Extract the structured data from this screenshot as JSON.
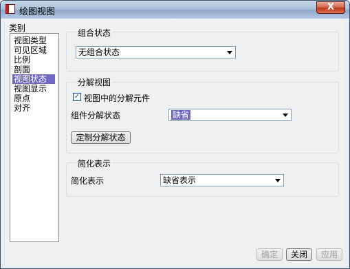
{
  "window": {
    "title": "绘图视图",
    "close_glyph": "X"
  },
  "category": {
    "label": "类别",
    "items": [
      "视图类型",
      "可见区域",
      "比例",
      "剖面",
      "视图状态",
      "视图显示",
      "原点",
      "对齐"
    ],
    "selected_index": 4
  },
  "combo_state": {
    "group_label": "组合状态",
    "value": "无组合状态"
  },
  "explode": {
    "group_label": "分解视图",
    "checkbox_label": "视图中的分解元件",
    "checked": true,
    "component_label": "组件分解状态",
    "component_value": "缺省",
    "custom_button": "定制分解状态"
  },
  "simplified": {
    "group_label": "简化表示",
    "row_label": "简化表示",
    "value": "缺省表示"
  },
  "footer": {
    "ok": "确定",
    "close": "关闭",
    "apply": "应用"
  },
  "colors": {
    "selection": "#7068c2",
    "titlebar": "#a9c0dc",
    "close": "#c0391c"
  }
}
